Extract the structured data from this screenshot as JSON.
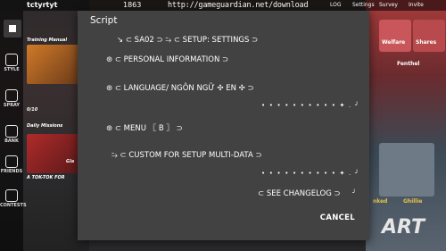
{
  "status_bar": {
    "url": "http://gameguardian.net/download",
    "player": "tctyrtyt",
    "coins": "1863"
  },
  "sidebar": {
    "items": [
      {
        "label": "STYLE"
      },
      {
        "label": "SPRAY"
      },
      {
        "label": "BANK"
      },
      {
        "label": "FRIENDS"
      },
      {
        "label": "CONTESTS"
      }
    ]
  },
  "background": {
    "training_manual": "Training Manual",
    "daily_missions": "Daily Missions",
    "progress": "0/10",
    "tok_tok": "A TOK-TOK FOR",
    "glass": "Gla",
    "right_welfare": "Welfare",
    "right_shares": "Shares",
    "right_fenthel": "Fenthel",
    "right_ghillie": "Ghillie",
    "right_linked": "nked",
    "right_start": "ART",
    "top_menu": [
      "LOG",
      "Settings",
      "Survey",
      "Invite"
    ]
  },
  "dialog": {
    "title": "Script",
    "items": [
      {
        "text": "↘        ⊂ SA02 ⊃      ⥲      ⊂ SETUP: SETTINGS ⊃"
      },
      {
        "text": "⊛  ⊂ PERSONAL INFORMATION ⊃"
      },
      {
        "text": "⊛  ⊂ LANGUAGE/ NGÔN NGỮ  ✣ EN ✣ ⊃"
      },
      {
        "text": "⊛  ⊂ MENU   〖 B 〗 ⊃"
      },
      {
        "text": "⥲   ⊂ CUSTOM FOR SETUP MULTI-DATA  ⊃"
      },
      {
        "text": "⊂ SEE CHANGELOG ⊃"
      }
    ],
    "dots_1": "• • • • • • • • • • ✦ . ╯",
    "dots_2": "• • • • • • • • • • ✦ . ╯",
    "dots_3": "╯",
    "cancel_label": "CANCEL"
  }
}
